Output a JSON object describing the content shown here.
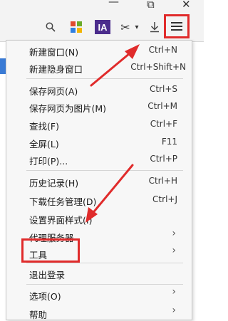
{
  "window_controls": {
    "minimize": "—",
    "restore": "⧉",
    "close": "✕"
  },
  "toolbar": {
    "icons": [
      "search-icon",
      "apps-grid-icon",
      "ia-extension-icon",
      "scissors-icon",
      "download-icon",
      "menu-icon"
    ],
    "ia_label": "IA",
    "scissors_glyph": "✂",
    "dropdown_glyph": "▾",
    "search_glyph": "🔍",
    "download_glyph": "⤓"
  },
  "menu": {
    "items": [
      {
        "label": "新建窗口(N)",
        "shortcut": "Ctrl+N"
      },
      {
        "label": "新建隐身窗口",
        "shortcut": "Ctrl+Shift+N"
      },
      {
        "label": "保存网页(A)",
        "shortcut": "Ctrl+S"
      },
      {
        "label": "保存网页为图片(M)",
        "shortcut": "Ctrl+M"
      },
      {
        "label": "查找(F)",
        "shortcut": "Ctrl+F"
      },
      {
        "label": "全屏(L)",
        "shortcut": "F11"
      },
      {
        "label": "打印(P)...",
        "shortcut": "Ctrl+P"
      },
      {
        "label": "历史记录(H)",
        "shortcut": "Ctrl+H"
      },
      {
        "label": "下载任务管理(D)",
        "shortcut": "Ctrl+J"
      },
      {
        "label": "设置界面样式(I)",
        "shortcut": ""
      },
      {
        "label": "代理服务器",
        "shortcut": ""
      },
      {
        "label": "工具",
        "shortcut": ""
      },
      {
        "label": "退出登录",
        "shortcut": ""
      },
      {
        "label": "选项(O)",
        "shortcut": ""
      },
      {
        "label": "帮助",
        "shortcut": ""
      }
    ],
    "submenu_glyph": "›"
  },
  "colors": {
    "annotation_red": "#e02b2b",
    "ia_purple": "#4b2c8c"
  }
}
